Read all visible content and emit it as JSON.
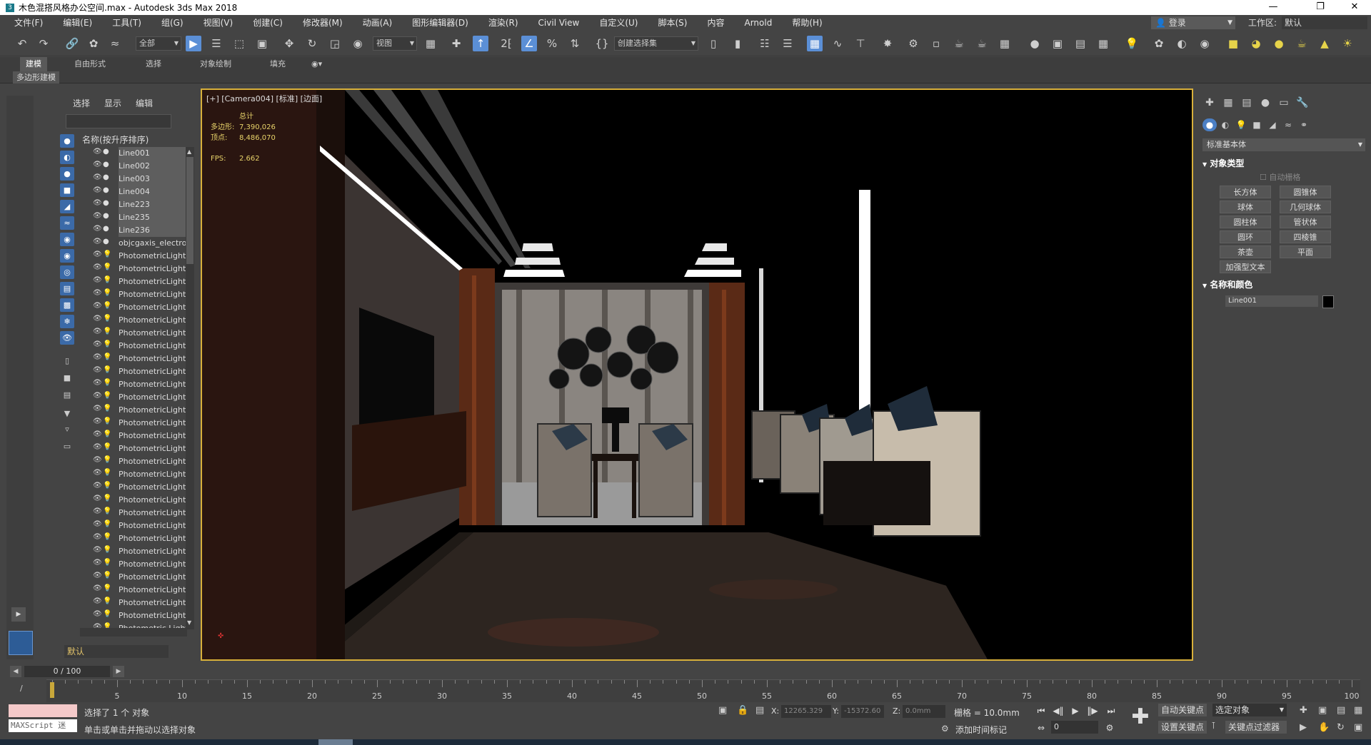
{
  "window": {
    "title": "木色混搭风格办公空间.max - Autodesk 3ds Max 2018",
    "app_icon": "3",
    "controls": [
      "—",
      "❐",
      "✕"
    ]
  },
  "menu": [
    "文件(F)",
    "编辑(E)",
    "工具(T)",
    "组(G)",
    "视图(V)",
    "创建(C)",
    "修改器(M)",
    "动画(A)",
    "图形编辑器(D)",
    "渲染(R)",
    "Civil View",
    "自定义(U)",
    "脚本(S)",
    "内容",
    "Arnold",
    "帮助(H)"
  ],
  "user": {
    "login_label": "登录",
    "workspace_label": "工作区:",
    "workspace_value": "默认"
  },
  "toolbar": {
    "selection_filter": "全部",
    "ref_coord": "视图",
    "named_selection": "创建选择集"
  },
  "ribbon": {
    "tabs": [
      "建模",
      "自由形式",
      "选择",
      "对象绘制",
      "填充"
    ],
    "active_tab": "建模",
    "sub_label": "多边形建模"
  },
  "scene_explorer": {
    "tabs": [
      "选择",
      "显示",
      "编辑"
    ],
    "header": "名称(按升序排序)",
    "items": [
      "Line001",
      "Line002",
      "Line003",
      "Line004",
      "Line223",
      "Line235",
      "Line236",
      "objcgaxis_electro",
      "PhotometricLight",
      "PhotometricLight",
      "PhotometricLight",
      "PhotometricLight",
      "PhotometricLight",
      "PhotometricLight",
      "PhotometricLight",
      "PhotometricLight",
      "PhotometricLight",
      "PhotometricLight",
      "PhotometricLight",
      "PhotometricLight",
      "PhotometricLight",
      "PhotometricLight",
      "PhotometricLight",
      "PhotometricLight",
      "PhotometricLight",
      "PhotometricLight",
      "PhotometricLight",
      "PhotometricLight",
      "PhotometricLight",
      "PhotometricLight",
      "PhotometricLight",
      "PhotometricLight",
      "PhotometricLight",
      "PhotometricLight",
      "PhotometricLight",
      "PhotometricLight",
      "PhotometricLight",
      "Photometric Light"
    ],
    "layer": "默认"
  },
  "viewport": {
    "label": "[+] [Camera004] [标准] [边面]",
    "stats_title": "总计",
    "stats": [
      {
        "k": "多边形:",
        "v": "7,390,026"
      },
      {
        "k": "顶点:",
        "v": "8,486,070"
      }
    ],
    "fps_label": "FPS:",
    "fps_value": "2.662"
  },
  "command_panel": {
    "dropdown": "标准基本体",
    "rollout_object_type": "对象类型",
    "autogrid": "自动栅格",
    "buttons": [
      "长方体",
      "圆锥体",
      "球体",
      "几何球体",
      "圆柱体",
      "管状体",
      "圆环",
      "四棱锥",
      "茶壶",
      "平面",
      "加强型文本"
    ],
    "rollout_name_color": "名称和颜色",
    "object_name": "Line001",
    "object_color": "#000000"
  },
  "timeline": {
    "frame_display": "0 / 100",
    "ticks": [
      5,
      10,
      15,
      20,
      25,
      30,
      35,
      40,
      45,
      50,
      55,
      60,
      65,
      70,
      75,
      80,
      85,
      90,
      95,
      100
    ],
    "current_frame": 0
  },
  "status": {
    "maxscript": "MAXScript 迷",
    "line1": "选择了 1 个 对象",
    "line2": "单击或单击并拖动以选择对象",
    "x_label": "X:",
    "x_value": "12265.329",
    "y_label": "Y:",
    "y_value": "-15372.60",
    "z_label": "Z:",
    "z_value": "0.0mm",
    "grid": "栅格 = 10.0mm",
    "add_time_tag": "添加时间标记",
    "auto_key": "自动关键点",
    "set_key": "设置关键点",
    "selected_object": "选定对象",
    "key_filter": "关键点过滤器",
    "frame": "0"
  }
}
